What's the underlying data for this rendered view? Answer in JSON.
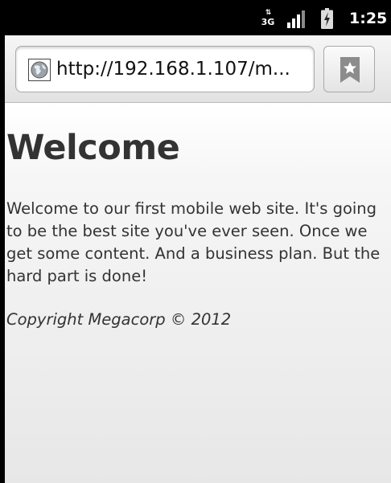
{
  "status_bar": {
    "network_label": "3G",
    "network_arrows": "⇅",
    "time": "1:25"
  },
  "browser": {
    "url": "http://192.168.1.107/m..."
  },
  "page": {
    "heading": "Welcome",
    "intro": "Welcome to our first mobile web site. It's going to be the best site you've ever seen. Once we get some content. And a business plan. But the hard part is done!",
    "copyright": "Copyright Megacorp © 2012"
  },
  "colors": {
    "status_bar_background": "#000000",
    "page_text": "#333333",
    "toolbar_background": "#ececec"
  },
  "icons": {
    "network": "network-3g-icon",
    "signal": "signal-strength-icon",
    "battery": "battery-charging-icon",
    "favicon": "globe-icon",
    "bookmark": "bookmark-star-icon"
  }
}
